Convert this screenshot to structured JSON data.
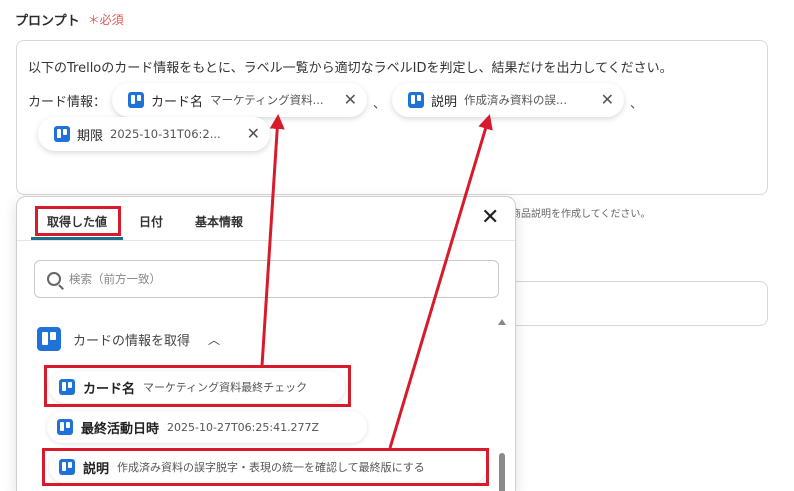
{
  "field": {
    "title": "プロンプト",
    "required": "＊必須"
  },
  "prompt": {
    "line1": "以下のTrelloのカード情報をもとに、ラベル一覧から適切なラベルIDを判定し、結果だけを出力してください。",
    "line2_label": "カード情報：",
    "separator": "、",
    "chips": [
      {
        "name": "カード名",
        "value": "マーケティング資料..."
      },
      {
        "name": "説明",
        "value": "作成済み資料の誤..."
      },
      {
        "name": "期限",
        "value": "2025-10-31T06:2..."
      }
    ]
  },
  "background": {
    "hint": "商品説明を作成してください。"
  },
  "dropdown": {
    "tabs": [
      {
        "label": "取得した値"
      },
      {
        "label": "日付"
      },
      {
        "label": "基本情報"
      }
    ],
    "search_placeholder": "検索（前方一致）",
    "group_title": "カードの情報を取得",
    "items": [
      {
        "name": "カード名",
        "value": "マーケティング資料最終チェック"
      },
      {
        "name": "最終活動日時",
        "value": "2025-10-27T06:25:41.277Z"
      },
      {
        "name": "説明",
        "value": "作成済み資料の誤字脱字・表現の統一を確認して最終版にする"
      }
    ]
  },
  "icons": {
    "chip_icon": "trello-icon",
    "remove_icon": "close-icon",
    "search_icon": "search-icon",
    "chevron": "chevron-up-icon"
  },
  "colors": {
    "highlight": "#d81b2c",
    "trello": "#1f73d8",
    "tab_underline": "#1e6e8a",
    "required": "#e05a5a"
  }
}
